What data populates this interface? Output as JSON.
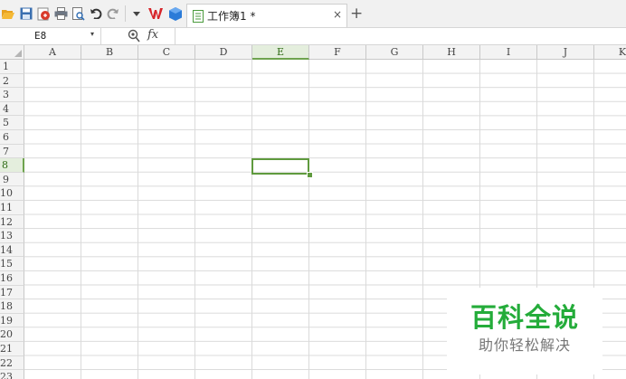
{
  "toolbar": {
    "icons": [
      "open-folder-icon",
      "save-icon",
      "export-pdf-icon",
      "print-icon",
      "print-preview-icon",
      "undo-icon",
      "redo-icon",
      "customize-dropdown-icon",
      "wps-logo-icon",
      "cloud-cube-icon"
    ]
  },
  "tabs": {
    "document_name": "工作簿1 *",
    "close_glyph": "×",
    "new_tab_glyph": "+"
  },
  "formula_bar": {
    "name_box_value": "E8",
    "name_box_arrow": "▾",
    "fx_label": "fx",
    "formula_value": ""
  },
  "sheet": {
    "columns": [
      "A",
      "B",
      "C",
      "D",
      "E",
      "F",
      "G",
      "H",
      "I",
      "J",
      "K"
    ],
    "rows": [
      "1",
      "2",
      "3",
      "4",
      "5",
      "6",
      "7",
      "8",
      "9",
      "10",
      "11",
      "12",
      "13",
      "14",
      "15",
      "16",
      "17",
      "18",
      "19",
      "20",
      "21",
      "22",
      "23"
    ],
    "active_column": "E",
    "active_row": "8",
    "selection_color": "#5f9a3e"
  },
  "watermark": {
    "title": "百科全说",
    "subtitle": "助你轻松解决",
    "title_color": "#24ac3a"
  }
}
